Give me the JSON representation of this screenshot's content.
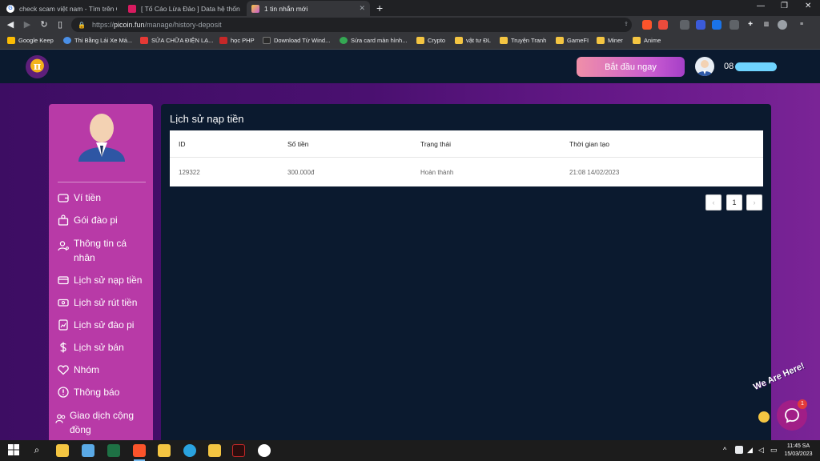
{
  "browser": {
    "tabs": [
      {
        "title": "check scam việt nam - Tìm trên Google",
        "active": false
      },
      {
        "title": "[ Tố Cáo Lừa Đảo ] Data hệ thống Che",
        "active": false
      },
      {
        "title": "1 tin nhắn mới",
        "active": true
      }
    ],
    "url": {
      "protocol": "https://",
      "host": "picoin.fun",
      "path": "/manage/history-deposit"
    },
    "bookmarks": [
      "Google Keep",
      "Thi Bằng Lái Xe Má...",
      "SỬA CHỮA ĐIỆN LẠ...",
      "học PHP",
      "Download Từ Wind...",
      "Sửa card màn hình...",
      "Crypto",
      "vật tư ĐL",
      "Truyện Tranh",
      "GameFI",
      "Miner",
      "Anime"
    ]
  },
  "header": {
    "logo_glyph": "π",
    "start_button": "Bắt đầu ngay",
    "phone_prefix": "08"
  },
  "sidebar": {
    "items": [
      {
        "label": "Ví tiền",
        "icon": "wallet-icon"
      },
      {
        "label": "Gói đào pi",
        "icon": "package-icon"
      },
      {
        "label": "Thông tin cá nhân",
        "icon": "user-settings-icon"
      },
      {
        "label": "Lịch sử nạp tiền",
        "icon": "credit-card-icon"
      },
      {
        "label": "Lịch sử rút tiền",
        "icon": "cash-icon"
      },
      {
        "label": "Lịch sử đào pi",
        "icon": "chart-file-icon"
      },
      {
        "label": "Lịch sử bán",
        "icon": "dollar-icon"
      },
      {
        "label": "Nhóm",
        "icon": "heart-handshake-icon"
      },
      {
        "label": "Thông báo",
        "icon": "alert-circle-icon"
      },
      {
        "label": "Giao dịch cộng đồng",
        "icon": "users-icon"
      }
    ]
  },
  "main": {
    "title": "Lịch sử nạp tiền",
    "table": {
      "headers": [
        "ID",
        "Số tiền",
        "Trạng thái",
        "Thời gian tạo"
      ],
      "rows": [
        [
          "129322",
          "300.000đ",
          "Hoàn thành",
          "21:08 14/02/2023"
        ]
      ]
    },
    "pagination": {
      "prev": "‹",
      "current": "1",
      "next": "›"
    }
  },
  "chat": {
    "banner": "We Are Here!",
    "badge": "1"
  },
  "taskbar": {
    "time": "11:45 SA",
    "date": "15/03/2023"
  }
}
